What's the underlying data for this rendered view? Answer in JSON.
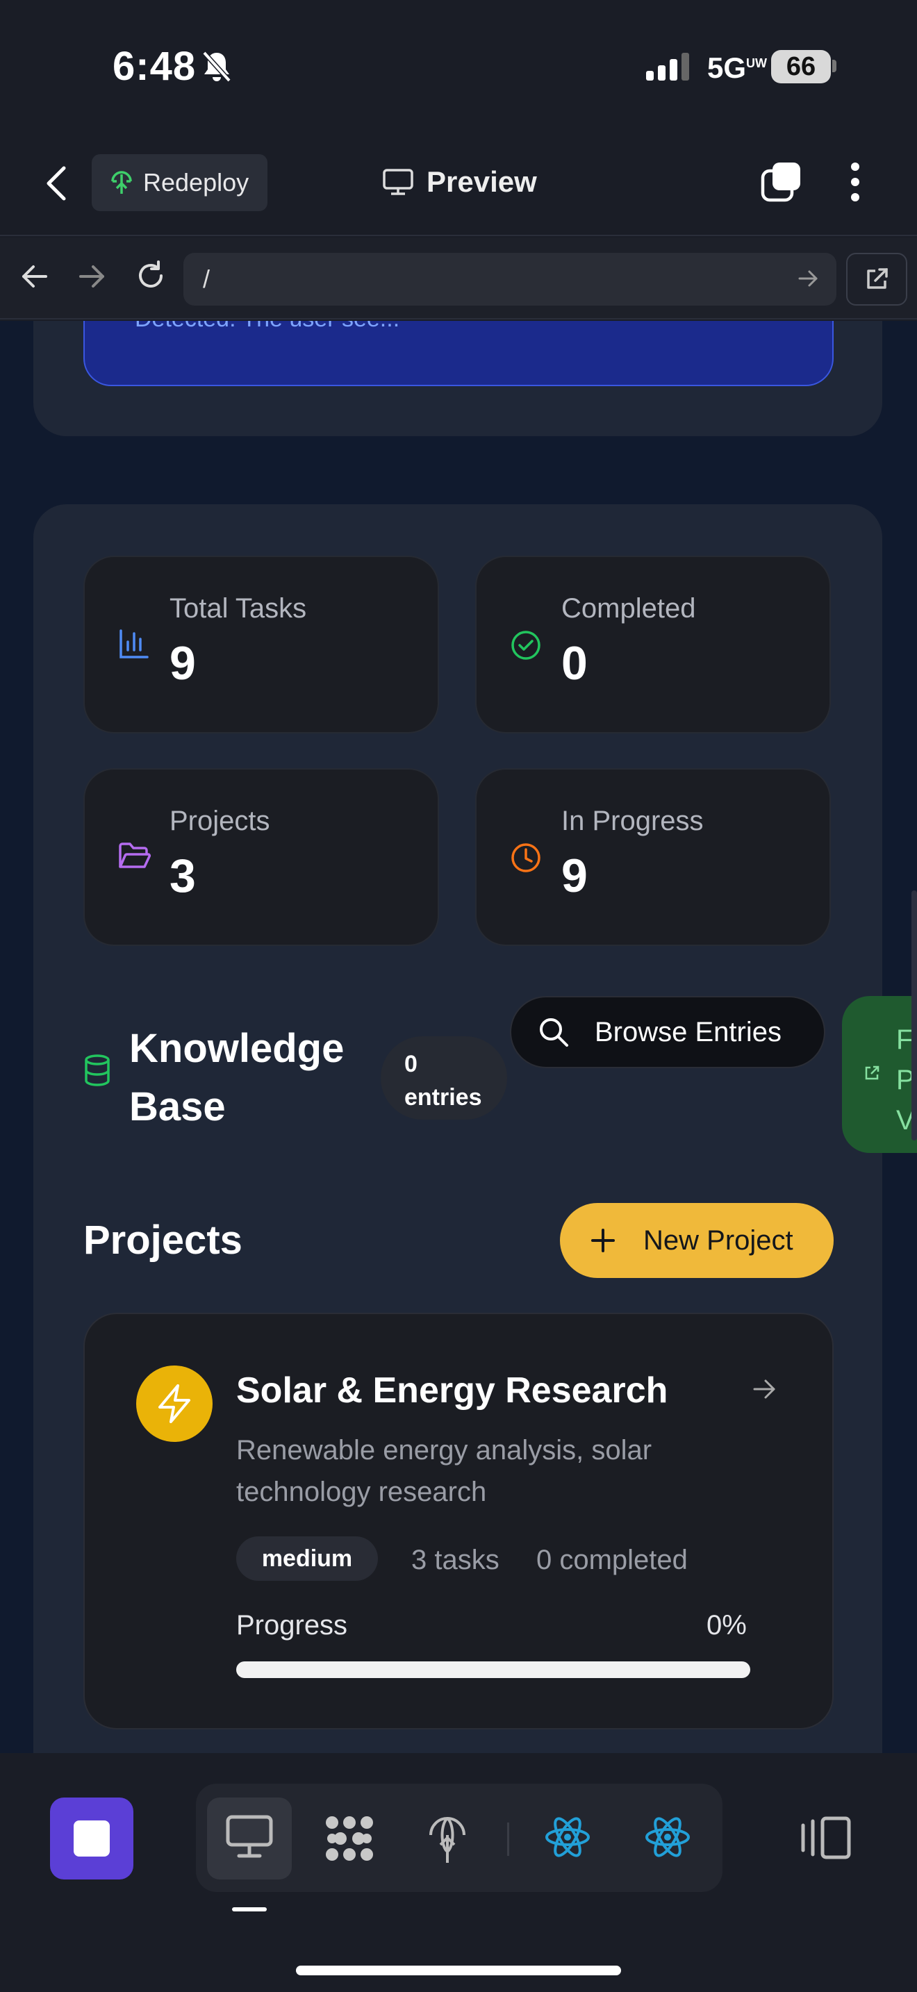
{
  "status_bar": {
    "time": "6:48",
    "network": "5G",
    "network_sup": "UW",
    "battery": "66"
  },
  "header": {
    "redeploy_label": "Redeploy",
    "preview_label": "Preview"
  },
  "url_bar": {
    "path": "/"
  },
  "alert_text": "Detected: The user see...",
  "stats": [
    {
      "label": "Total Tasks",
      "value": "9",
      "icon": "bar-chart-icon",
      "color": "#4f8bf5"
    },
    {
      "label": "Completed",
      "value": "0",
      "icon": "check-circle-icon",
      "color": "#22c55e"
    },
    {
      "label": "Projects",
      "value": "3",
      "icon": "folder-open-icon",
      "color": "#b56cf0"
    },
    {
      "label": "In Progress",
      "value": "9",
      "icon": "clock-icon",
      "color": "#f97316"
    }
  ],
  "knowledge_base": {
    "title": "Knowledge Base",
    "count_number": "0",
    "count_label": "entries",
    "browse_label": "Browse Entries",
    "side_button_lines": [
      "F",
      "P",
      "V"
    ]
  },
  "projects_section": {
    "title": "Projects",
    "new_button": "New Project"
  },
  "project_card": {
    "title": "Solar & Energy Research",
    "description": "Renewable energy analysis, solar technology research",
    "priority": "medium",
    "tasks": "3 tasks",
    "completed": "0 completed",
    "progress_label": "Progress",
    "progress_pct": "0%",
    "icon": "lightning-icon",
    "accent": "#eab308"
  },
  "toolbar": {
    "icons": [
      "desktop-icon",
      "workspaces-icon",
      "deploy-icon",
      "react-icon",
      "react-icon",
      "split-view-icon"
    ]
  }
}
